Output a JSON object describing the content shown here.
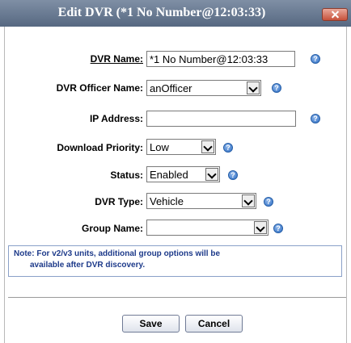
{
  "dialog": {
    "title": "Edit DVR (*1 No Number@12:03:33)",
    "close_icon": "close-x-icon"
  },
  "form": {
    "dvr_name": {
      "label": "DVR Name:",
      "value": "*1 No Number@12:03:33"
    },
    "dvr_officer_name": {
      "label": "DVR Officer Name:",
      "value": "anOfficer"
    },
    "ip_address": {
      "label": "IP Address:",
      "value": ""
    },
    "download_priority": {
      "label": "Download Priority:",
      "value": "Low"
    },
    "status": {
      "label": "Status:",
      "value": "Enabled"
    },
    "dvr_type": {
      "label": "DVR Type:",
      "value": "Vehicle"
    },
    "group_name": {
      "label": "Group Name:",
      "value": ""
    },
    "help_icon": "help-question-icon"
  },
  "note": {
    "line1": "Note: For v2/v3 units, additional group options will be",
    "line2": "available after DVR discovery."
  },
  "buttons": {
    "save": "Save",
    "cancel": "Cancel"
  },
  "colors": {
    "title_bar": "#6a7a92",
    "close_button": "#c7513a",
    "help_icon": "#2f6fc4",
    "note_text": "#1d3a8a"
  }
}
